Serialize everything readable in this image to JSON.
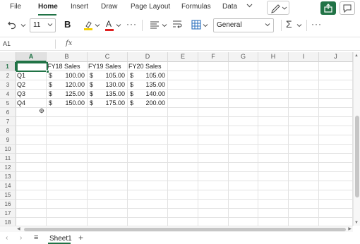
{
  "menu": {
    "tabs": [
      "File",
      "Home",
      "Insert",
      "Draw",
      "Page Layout",
      "Formulas",
      "Data"
    ],
    "active_tab": "Home",
    "more_icon": "chevron-down-icon",
    "accent": "#217346"
  },
  "toolbar": {
    "undo_icon": "undo-icon",
    "font_size": "11",
    "bold_label": "B",
    "highlight_color": "#f5d000",
    "font_color": "#e02020",
    "font_color_label": "A",
    "number_format": "General",
    "sum_label": "Σ"
  },
  "formula_bar": {
    "name_box": "A1",
    "fx_label": "fx",
    "formula": ""
  },
  "grid": {
    "columns": [
      "A",
      "B",
      "C",
      "D",
      "E",
      "F",
      "G",
      "H",
      "I",
      "J"
    ],
    "selected_column": "A",
    "selected_row": "1",
    "rows": [
      "1",
      "2",
      "3",
      "4",
      "5",
      "6",
      "7",
      "8",
      "9",
      "10",
      "11",
      "12",
      "13",
      "14",
      "15",
      "16",
      "17",
      "18"
    ],
    "headers": [
      "FY18 Sales",
      "FY19 Sales",
      "FY20 Sales"
    ],
    "data": [
      {
        "label": "Q1",
        "values": [
          "100.00",
          "105.00",
          "105.00"
        ]
      },
      {
        "label": "Q2",
        "values": [
          "120.00",
          "130.00",
          "135.00"
        ]
      },
      {
        "label": "Q3",
        "values": [
          "125.00",
          "135.00",
          "140.00"
        ]
      },
      {
        "label": "Q4",
        "values": [
          "150.00",
          "175.00",
          "200.00"
        ]
      }
    ],
    "currency_symbol": "$"
  },
  "sheets": {
    "tabs": [
      "Sheet1"
    ],
    "active": "Sheet1",
    "add_label": "+"
  }
}
